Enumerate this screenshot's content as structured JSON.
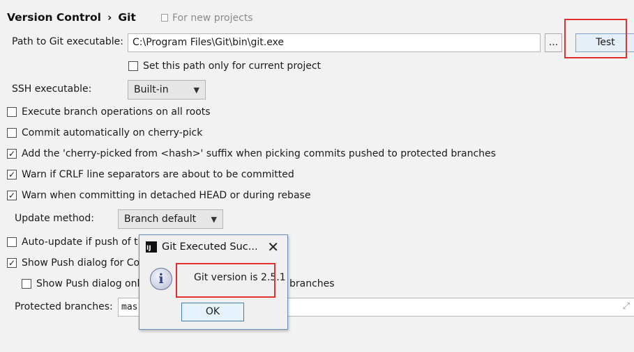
{
  "breadcrumb": {
    "parent": "Version Control",
    "separator": "›",
    "current": "Git"
  },
  "scope_hint": "For new projects",
  "git_path": {
    "label": "Path to Git executable:",
    "value": "C:\\Program Files\\Git\\bin\\git.exe",
    "browse_label": "...",
    "test_label": "Test",
    "current_project_checkbox": {
      "label": "Set this path only for current project",
      "checked": false
    }
  },
  "ssh": {
    "label": "SSH executable:",
    "selected": "Built-in"
  },
  "options": [
    {
      "label": "Execute branch operations on all roots",
      "checked": false
    },
    {
      "label": "Commit automatically on cherry-pick",
      "checked": false
    },
    {
      "label": "Add the 'cherry-picked from <hash>' suffix when picking commits pushed to protected branches",
      "checked": true
    },
    {
      "label": "Warn if CRLF line separators are about to be committed",
      "checked": true
    },
    {
      "label": "Warn when committing in detached HEAD or during rebase",
      "checked": true
    }
  ],
  "update_method": {
    "label": "Update method:",
    "selected": "Branch default"
  },
  "auto_update": {
    "label": "Auto-update if push of th",
    "checked": false
  },
  "show_push": {
    "label": "Show Push dialog for Con",
    "checked": true
  },
  "show_push_only": {
    "label": "Show Push dialog only",
    "suffix": "branches",
    "checked": false
  },
  "protected_branches": {
    "label": "Protected branches:",
    "value": "mas"
  },
  "dialog": {
    "title": "Git Executed Suc...",
    "close": "✕",
    "message": "Git version is 2.5.1",
    "ok_label": "OK",
    "app_icon_text": "IJ"
  },
  "colors": {
    "highlight": "#e0312f",
    "dialog_border": "#6a8cc2",
    "button_focus_border": "#3c7fb1"
  }
}
